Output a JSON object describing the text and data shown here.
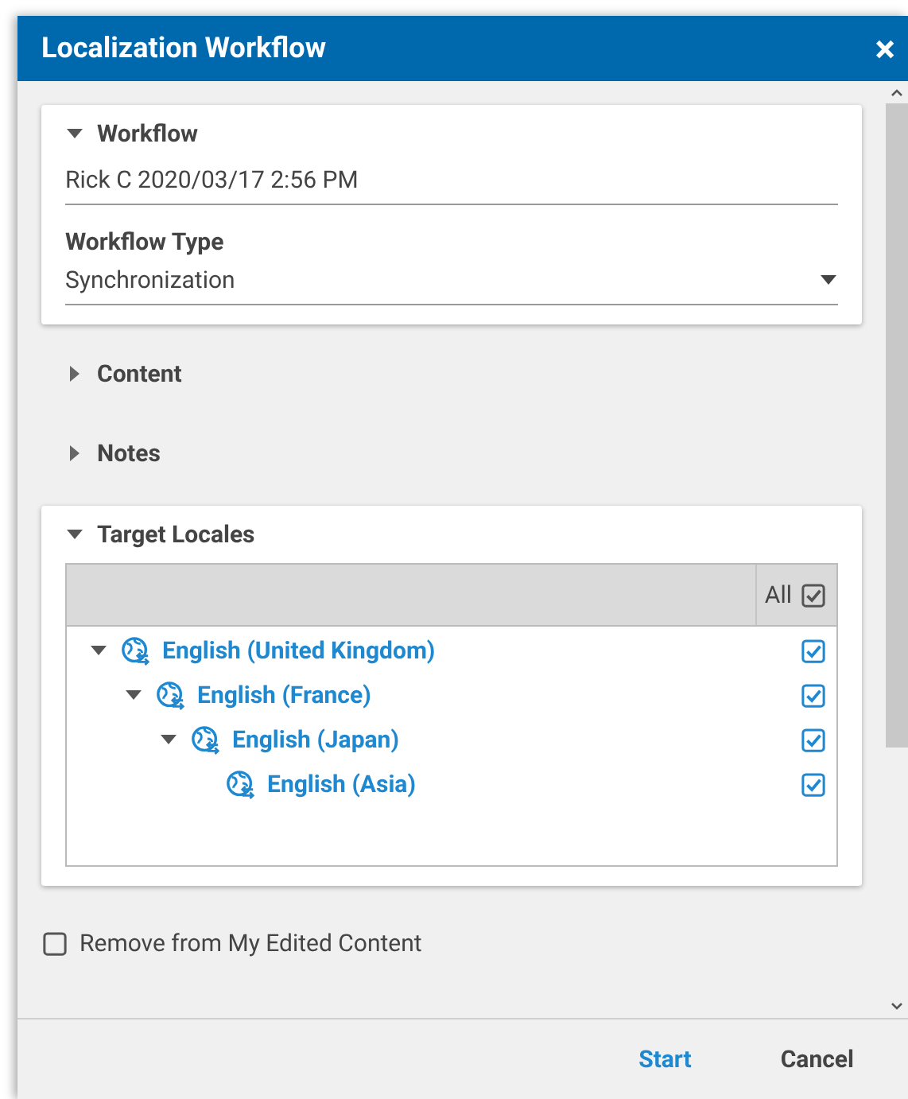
{
  "dialog": {
    "title": "Localization Workflow",
    "close": "×"
  },
  "sections": [
    {
      "kind": "workflow",
      "title": "Workflow",
      "expanded": true,
      "name_value": "Rick C 2020/03/17 2:56 PM",
      "type_label": "Workflow Type",
      "type_value": "Synchronization"
    },
    {
      "kind": "plain",
      "title": "Content",
      "expanded": false
    },
    {
      "kind": "plain",
      "title": "Notes",
      "expanded": false
    },
    {
      "kind": "locales",
      "title": "Target Locales",
      "expanded": true,
      "all_label": "All",
      "all_checked": true,
      "tree": [
        {
          "label": "English (United Kingdom)",
          "expanded": true,
          "checked": true,
          "children": [
            {
              "label": "English (France)",
              "expanded": true,
              "checked": true,
              "children": [
                {
                  "label": "English (Japan)",
                  "expanded": true,
                  "checked": true,
                  "children": [
                    {
                      "label": "English (Asia)",
                      "checked": true
                    }
                  ]
                }
              ]
            }
          ]
        }
      ]
    }
  ],
  "remove_option": {
    "label": "Remove from My Edited Content",
    "checked": false
  },
  "buttons": [
    {
      "label": "Start",
      "kind": "primary"
    },
    {
      "label": "Cancel",
      "kind": "secondary"
    }
  ]
}
